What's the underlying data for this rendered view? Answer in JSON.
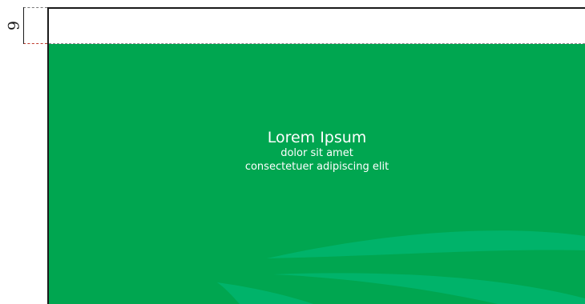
{
  "measure": {
    "label": "6"
  },
  "content": {
    "title": "Lorem Ipsum",
    "line1": "dolor sit amet",
    "line2": "consectetuer adipiscing elit"
  },
  "colors": {
    "background": "#00a650",
    "swoosh": "#00b36a",
    "text": "#ffffff",
    "frame": "#1a1a1a"
  }
}
